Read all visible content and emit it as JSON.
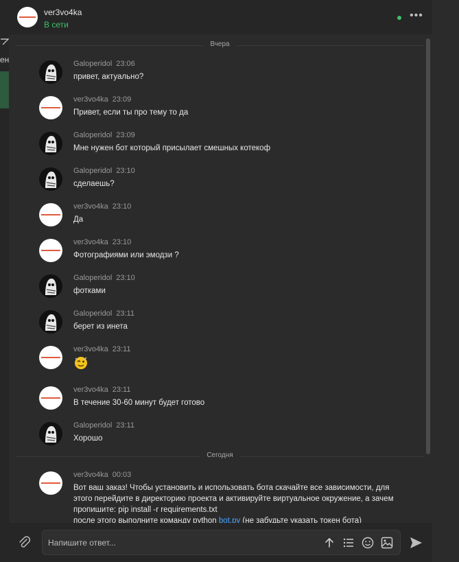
{
  "header": {
    "name": "ver3vo4ka",
    "status": "В сети"
  },
  "sidebar": {
    "fragment": "ен"
  },
  "separators": {
    "yesterday": "Вчера",
    "today": "Сегодня"
  },
  "messages": [
    {
      "author": "Galoperidol",
      "time": "23:06",
      "text": "привет, актуально?"
    },
    {
      "author": "ver3vo4ka",
      "time": "23:09",
      "text": "Привет, если ты про тему то да"
    },
    {
      "author": "Galoperidol",
      "time": "23:09",
      "text": "Мне нужен бот который присылает смешных котекоф"
    },
    {
      "author": "Galoperidol",
      "time": "23:10",
      "text": "сделаешь?"
    },
    {
      "author": "ver3vo4ka",
      "time": "23:10",
      "text": "Да"
    },
    {
      "author": "ver3vo4ka",
      "time": "23:10",
      "text": "Фотографиями или эмодзи ?"
    },
    {
      "author": "Galoperidol",
      "time": "23:10",
      "text": "фотками"
    },
    {
      "author": "Galoperidol",
      "time": "23:11",
      "text": "берет из инета"
    },
    {
      "author": "ver3vo4ka",
      "time": "23:11",
      "emoji": "winking-face-emoji"
    },
    {
      "author": "ver3vo4ka",
      "time": "23:11",
      "text": "В течение 30-60 минут будет готово"
    },
    {
      "author": "Galoperidol",
      "time": "23:11",
      "text": "Хорошо"
    },
    {
      "author": "ver3vo4ka",
      "time": "00:03",
      "text_line1": "Вот ваш заказ! Чтобы установить и использовать бота скачайте все зависимости, для этого перейдите в директорию проекта и активируйте виртуальное окружение, а зачем пропишите: pip install -r requirements.txt",
      "text_line2_before": "после этого выполните команду python ",
      "text_line2_link": "bot.py",
      "text_line2_after": " (не забудьте указать токен бота)"
    }
  ],
  "composer": {
    "placeholder": "Напишите ответ..."
  },
  "colors": {
    "accent_green": "#3ec16a",
    "link": "#4aa3ff",
    "background": "#2b2b2b"
  }
}
